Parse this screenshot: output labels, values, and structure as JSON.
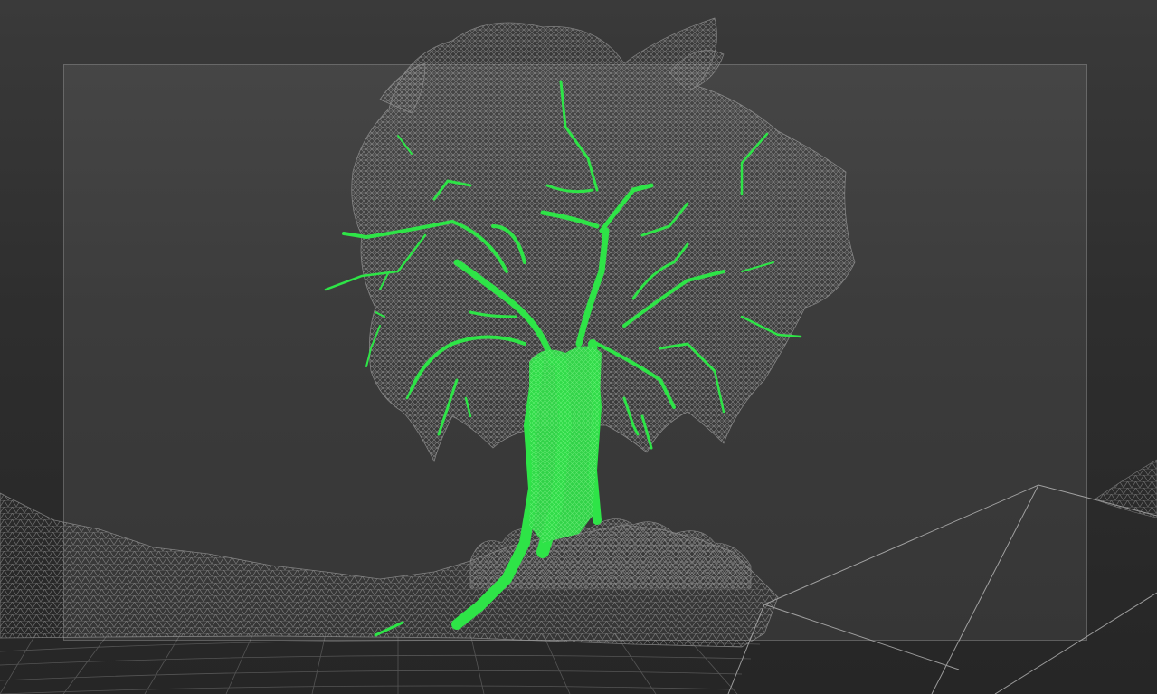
{
  "viewport": {
    "background_top": "#3a3a3a",
    "background_bottom": "#262626",
    "wireframe_color": "#8a8a8a",
    "selected_color": "#1fe23a",
    "safe_frame_color": "#aaaaaa"
  },
  "scene": {
    "objects": [
      {
        "name": "terrain",
        "display": "wireframe",
        "selected": false
      },
      {
        "name": "tree-trunk-and-branches",
        "display": "wireframe",
        "selected": true
      },
      {
        "name": "tree-foliage",
        "display": "wireframe",
        "selected": false
      },
      {
        "name": "ground-grid",
        "display": "wireframe",
        "selected": false
      },
      {
        "name": "large-plane",
        "display": "wireframe",
        "selected": false
      }
    ]
  }
}
